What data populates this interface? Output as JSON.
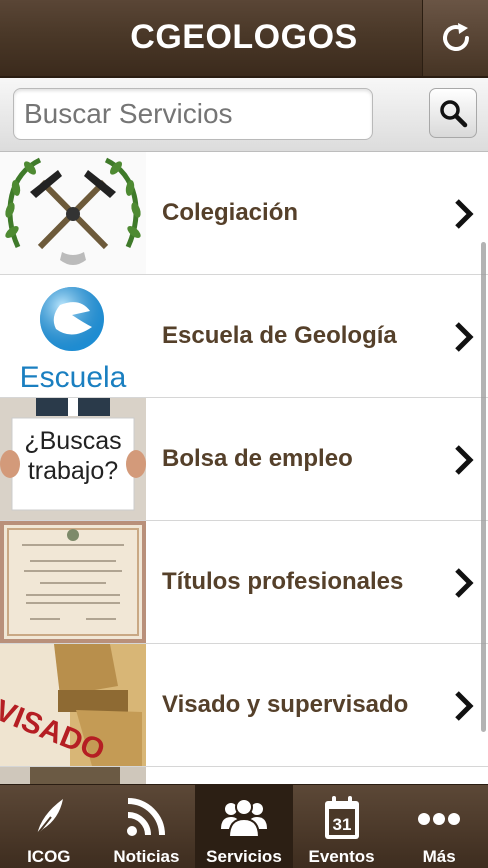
{
  "header": {
    "title": "CGEOLOGOS",
    "refresh_icon": "refresh-icon"
  },
  "search": {
    "placeholder": "Buscar Servicios",
    "search_icon": "search-icon"
  },
  "services": [
    {
      "label": "Colegiación",
      "thumb": "icog-emblem"
    },
    {
      "label": "Escuela de Geología",
      "thumb": "escuela-logo",
      "thumb_text": "Escuela"
    },
    {
      "label": "Bolsa de empleo",
      "thumb": "buscas-trabajo-sign",
      "thumb_text": "¿Buscas trabajo?"
    },
    {
      "label": "Títulos profesionales",
      "thumb": "diploma-image"
    },
    {
      "label": "Visado y supervisado",
      "thumb": "visado-stamp",
      "thumb_text": "VISADO"
    }
  ],
  "tabs": [
    {
      "label": "ICOG",
      "icon": "feather-icon",
      "active": false
    },
    {
      "label": "Noticias",
      "icon": "rss-icon",
      "active": false
    },
    {
      "label": "Servicios",
      "icon": "users-icon",
      "active": true
    },
    {
      "label": "Eventos",
      "icon": "calendar-icon",
      "active": false,
      "icon_text": "31"
    },
    {
      "label": "Más",
      "icon": "more-dots-icon",
      "active": false
    }
  ],
  "colors": {
    "header_brown": "#4a3828",
    "label_brown": "#55402a",
    "tab_active": "#2c1f14"
  }
}
